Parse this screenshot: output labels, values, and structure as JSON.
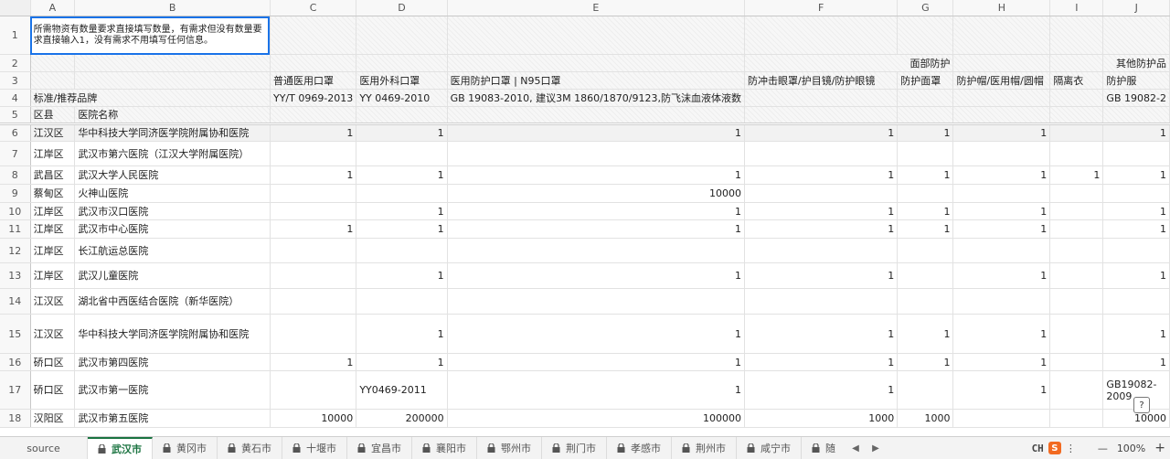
{
  "columns": [
    "A",
    "B",
    "C",
    "D",
    "E",
    "F",
    "G",
    "H",
    "I",
    "J"
  ],
  "row_numbers": [
    "1",
    "2",
    "3",
    "4",
    "5",
    "6",
    "7",
    "8",
    "9",
    "10",
    "11",
    "12",
    "13",
    "14",
    "15",
    "16",
    "17",
    "18"
  ],
  "instruction": "所需物资有数量要求直接填写数量，有需求但没有数量要求直接输入1，没有需求不用填写任何信息。",
  "group_headers": {
    "face": "面部防护",
    "other": "其他防护品"
  },
  "item_headers": [
    "普通医用口罩",
    "医用外科口罩",
    "医用防护口罩 | N95口罩",
    "防冲击眼罩/护目镜/防护眼镜",
    "防护面罩",
    "防护帽/医用帽/圆帽",
    "隔离衣",
    "防护服"
  ],
  "standard_label": "标准/推荐品牌",
  "standards": [
    "YY/T 0969-2013",
    "YY 0469-2010",
    "GB 19083-2010, 建议3M 1860/1870/9123,防飞沫血液体液数",
    "",
    "",
    "",
    "",
    "GB 19082-2"
  ],
  "district_header": "区县",
  "hospital_header": "医院名称",
  "rows": [
    {
      "district": "江汉区",
      "hospital": "华中科技大学同济医学院附属协和医院",
      "vals": [
        "1",
        "1",
        "1",
        "1",
        "1",
        "1",
        "",
        "1"
      ]
    },
    {
      "district": "江岸区",
      "hospital": "武汉市第六医院（江汉大学附属医院）",
      "vals": [
        "",
        "",
        "",
        "",
        "",
        "",
        "",
        ""
      ]
    },
    {
      "district": "武昌区",
      "hospital": "武汉大学人民医院",
      "vals": [
        "1",
        "1",
        "1",
        "1",
        "1",
        "1",
        "1",
        "1"
      ]
    },
    {
      "district": "蔡甸区",
      "hospital": "火神山医院",
      "vals": [
        "",
        "",
        "10000",
        "",
        "",
        "",
        "",
        ""
      ]
    },
    {
      "district": "江岸区",
      "hospital": "武汉市汉口医院",
      "vals": [
        "",
        "1",
        "1",
        "1",
        "1",
        "1",
        "",
        "1"
      ]
    },
    {
      "district": "江岸区",
      "hospital": "武汉市中心医院",
      "vals": [
        "1",
        "1",
        "1",
        "1",
        "1",
        "1",
        "",
        "1"
      ]
    },
    {
      "district": "江岸区",
      "hospital": "长江航运总医院",
      "vals": [
        "",
        "",
        "",
        "",
        "",
        "",
        "",
        ""
      ]
    },
    {
      "district": "江岸区",
      "hospital": "武汉儿童医院",
      "vals": [
        "",
        "1",
        "1",
        "1",
        "",
        "1",
        "",
        "1"
      ]
    },
    {
      "district": "江汉区",
      "hospital": "湖北省中西医结合医院（新华医院）",
      "vals": [
        "",
        "",
        "",
        "",
        "",
        "",
        "",
        ""
      ]
    },
    {
      "district": "江汉区",
      "hospital": "华中科技大学同济医学院附属协和医院",
      "vals": [
        "",
        "1",
        "1",
        "1",
        "1",
        "1",
        "",
        "1"
      ]
    },
    {
      "district": "硚口区",
      "hospital": "武汉市第四医院",
      "vals": [
        "1",
        "1",
        "1",
        "1",
        "1",
        "1",
        "",
        "1"
      ]
    },
    {
      "district": "硚口区",
      "hospital": "武汉市第一医院",
      "vals": [
        "",
        "YY0469-2011",
        "1",
        "1",
        "",
        "1",
        "",
        "GB19082-2009"
      ]
    },
    {
      "district": "汉阳区",
      "hospital": "武汉市第五医院",
      "vals": [
        "10000",
        "200000",
        "100000",
        "1000",
        "1000",
        "",
        "",
        "10000"
      ]
    }
  ],
  "tabs": {
    "source": "source",
    "items": [
      "武汉市",
      "黄冈市",
      "黄石市",
      "十堰市",
      "宜昌市",
      "襄阳市",
      "鄂州市",
      "荆门市",
      "孝感市",
      "荆州市",
      "咸宁市",
      "随"
    ]
  },
  "toolbar": {
    "ime": "CH",
    "ime_badge": "S",
    "zoom": "100%",
    "minus": "—",
    "plus": "+",
    "prev": "◀",
    "next": "▶",
    "help": "?"
  },
  "colors": {
    "selection": "#1a73e8",
    "active_tab": "#1a7340",
    "ime": "#f26a21"
  }
}
